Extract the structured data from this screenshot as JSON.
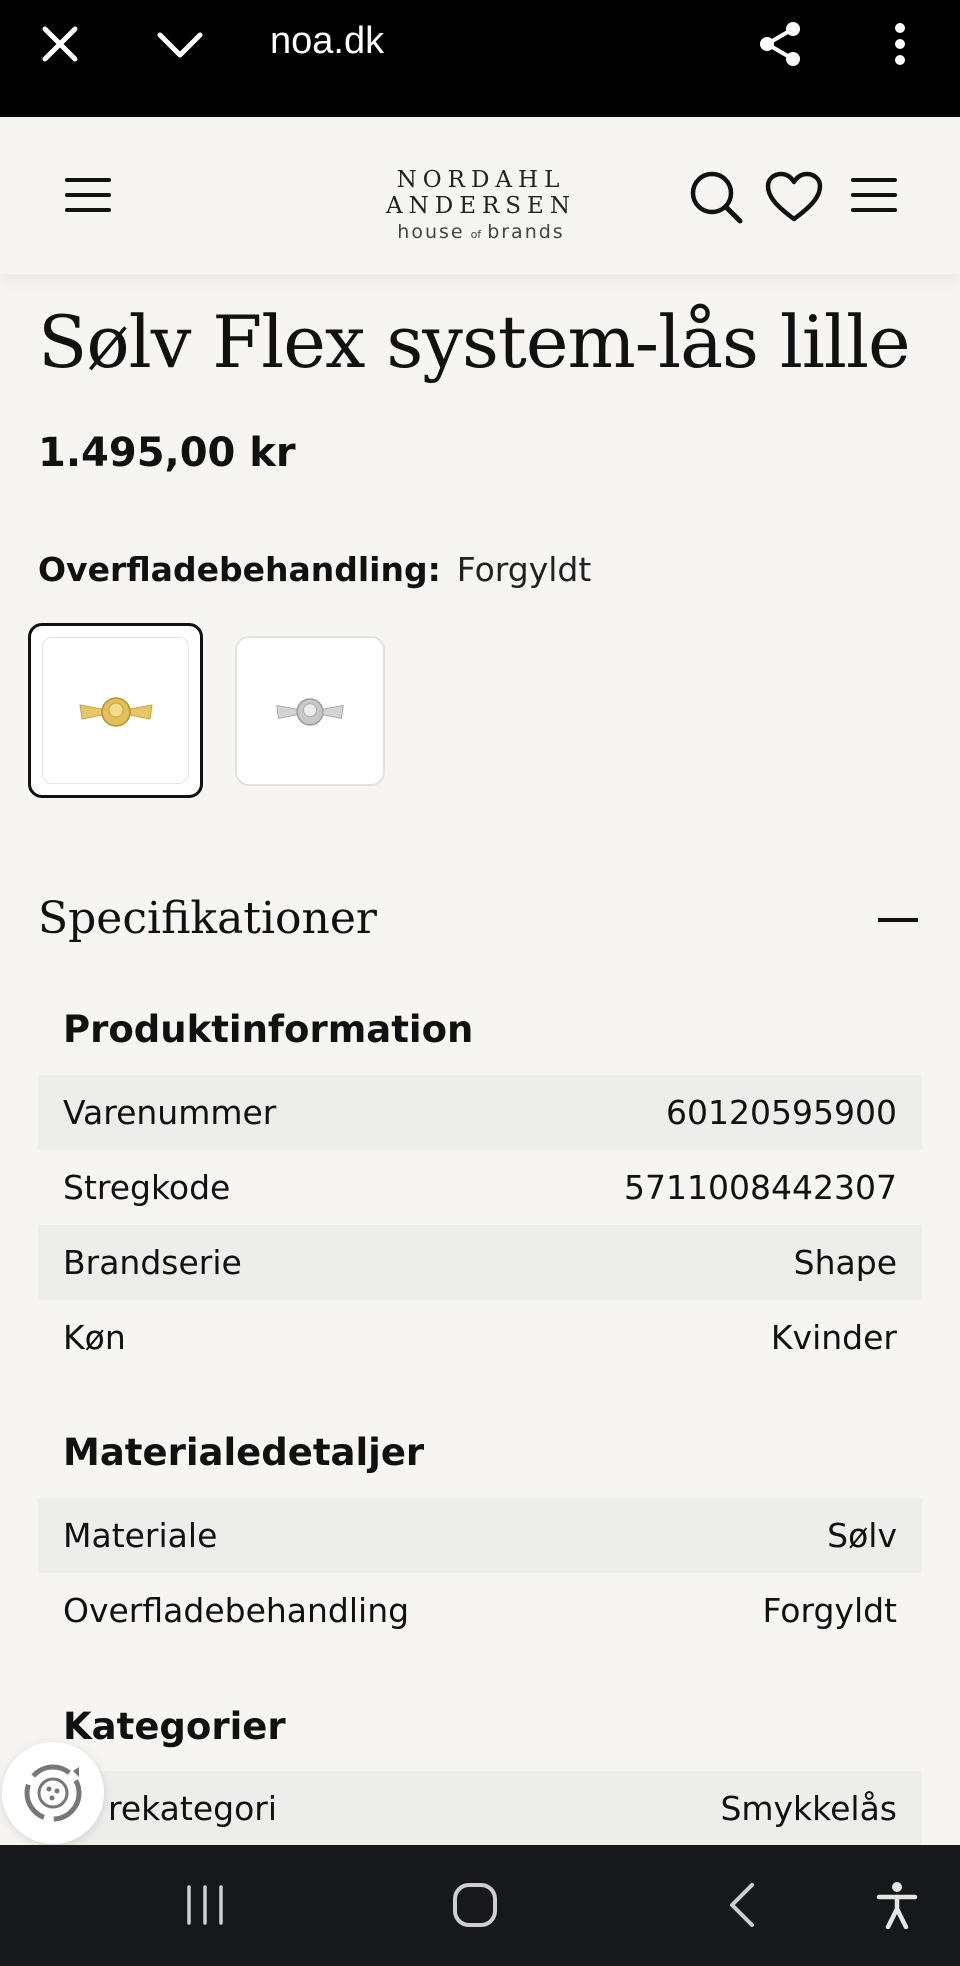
{
  "browser": {
    "url": "noa.dk",
    "icons": [
      "close-icon",
      "chevron-down-icon",
      "share-icon",
      "more-vertical-icon"
    ]
  },
  "header": {
    "logo_top": "NORDAHL ANDERSEN",
    "logo_house": "house",
    "logo_of": "of",
    "logo_brands": "brands",
    "icons": [
      "menu-icon",
      "search-icon",
      "heart-icon",
      "hamburger-icon"
    ]
  },
  "product": {
    "title": "Sølv Flex system-lås lille",
    "price": "1.495,00 kr",
    "option_label": "Overfladebehandling:",
    "option_value": "Forgyldt",
    "swatches": [
      {
        "name": "gold",
        "selected": true,
        "color": "#d9b54a"
      },
      {
        "name": "silver",
        "selected": false,
        "color": "#bfbfbf"
      }
    ]
  },
  "specs": {
    "heading": "Specifikationer",
    "groups": [
      {
        "title": "Produktinformation",
        "rows": [
          {
            "label": "Varenummer",
            "value": "60120595900"
          },
          {
            "label": "Stregkode",
            "value": "5711008442307"
          },
          {
            "label": "Brandserie",
            "value": "Shape"
          },
          {
            "label": "Køn",
            "value": "Kvinder"
          }
        ]
      },
      {
        "title": "Materialedetaljer",
        "rows": [
          {
            "label": "Materiale",
            "value": "Sølv"
          },
          {
            "label": "Overfladebehandling",
            "value": "Forgyldt"
          }
        ]
      },
      {
        "title": "Kategorier",
        "rows": [
          {
            "label": "rekategori",
            "value": "Smykkelås"
          }
        ]
      }
    ]
  },
  "colors": {
    "page_bg": "#f6f5f2",
    "row_shade": "#ededec",
    "browser_bar": "#000000",
    "nav_bar": "#16181b"
  }
}
